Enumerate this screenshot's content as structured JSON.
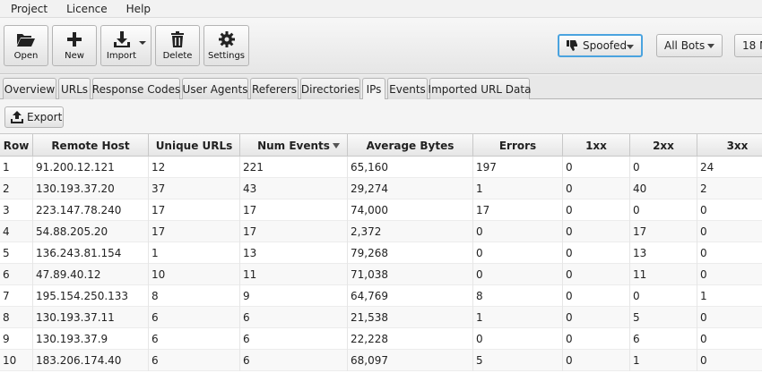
{
  "menu": [
    "Project",
    "Licence",
    "Help"
  ],
  "toolbar": {
    "open_label": "Open",
    "new_label": "New",
    "import_label": "Import",
    "delete_label": "Delete",
    "settings_label": "Settings"
  },
  "filters": {
    "spoofed_label": "Spoofed",
    "bots_label": "All Bots",
    "range_label": "18 M"
  },
  "tabs": [
    "Overview",
    "URLs",
    "Response Codes",
    "User Agents",
    "Referers",
    "Directories",
    "IPs",
    "Events",
    "Imported URL Data"
  ],
  "active_tab": "IPs",
  "export_label": "Export",
  "table": {
    "columns": [
      "Row",
      "Remote Host",
      "Unique URLs",
      "Num Events",
      "Average Bytes",
      "Errors",
      "1xx",
      "2xx",
      "3xx"
    ],
    "rows": [
      [
        "1",
        "91.200.12.121",
        "12",
        "221",
        "65,160",
        "197",
        "0",
        "0",
        "24"
      ],
      [
        "2",
        "130.193.37.20",
        "37",
        "43",
        "29,274",
        "1",
        "0",
        "40",
        "2"
      ],
      [
        "3",
        "223.147.78.240",
        "17",
        "17",
        "74,000",
        "17",
        "0",
        "0",
        "0"
      ],
      [
        "4",
        "54.88.205.20",
        "17",
        "17",
        "2,372",
        "0",
        "0",
        "17",
        "0"
      ],
      [
        "5",
        "136.243.81.154",
        "1",
        "13",
        "79,268",
        "0",
        "0",
        "13",
        "0"
      ],
      [
        "6",
        "47.89.40.12",
        "10",
        "11",
        "71,038",
        "0",
        "0",
        "11",
        "0"
      ],
      [
        "7",
        "195.154.250.133",
        "8",
        "9",
        "64,769",
        "8",
        "0",
        "0",
        "1"
      ],
      [
        "8",
        "130.193.37.11",
        "6",
        "6",
        "21,538",
        "1",
        "0",
        "5",
        "0"
      ],
      [
        "9",
        "130.193.37.9",
        "6",
        "6",
        "22,228",
        "0",
        "0",
        "6",
        "0"
      ],
      [
        "10",
        "183.206.174.40",
        "6",
        "6",
        "68,097",
        "5",
        "0",
        "1",
        "0"
      ]
    ]
  }
}
